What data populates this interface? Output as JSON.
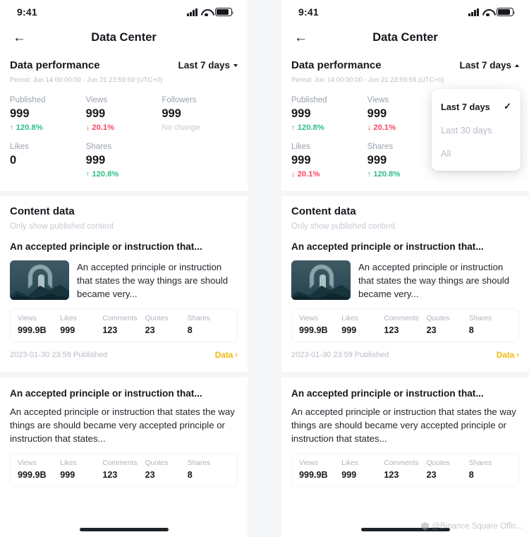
{
  "status_bar": {
    "time": "9:41",
    "icons": {
      "signal": "cellular-signal-icon",
      "wifi": "wifi-icon",
      "battery": "battery-icon"
    }
  },
  "nav": {
    "back_icon": "back-arrow-icon",
    "title": "Data Center"
  },
  "performance": {
    "title": "Data performance",
    "period_label": "Period: Jun 14 00:00:00 - Jun 21 23:59:59 (UTC+0)",
    "range_selected": "Last 7 days",
    "stats_left": [
      {
        "label": "Published",
        "value": "999",
        "delta": "↑ 120.8%",
        "dir": "up"
      },
      {
        "label": "Views",
        "value": "999",
        "delta": "↓ 20.1%",
        "dir": "down"
      },
      {
        "label": "Followers",
        "value": "999",
        "delta": "No change",
        "dir": "flat"
      },
      {
        "label": "Likes",
        "value": "0",
        "delta": "",
        "dir": "none"
      },
      {
        "label": "Shares",
        "value": "999",
        "delta": "↑ 120.8%",
        "dir": "up"
      }
    ],
    "stats_right": [
      {
        "label": "Published",
        "value": "999",
        "delta": "↑ 120.8%",
        "dir": "up"
      },
      {
        "label": "Views",
        "value": "999",
        "delta": "↓ 20.1%",
        "dir": "down"
      },
      {
        "label": "Likes",
        "value": "999",
        "delta": "↓ 20.1%",
        "dir": "down"
      },
      {
        "label": "Shares",
        "value": "999",
        "delta": "↑ 120.8%",
        "dir": "up"
      }
    ]
  },
  "dropdown": {
    "open": true,
    "check_glyph": "✓",
    "options": [
      {
        "label": "Last 7 days",
        "selected": true
      },
      {
        "label": "Last 30 days",
        "selected": false
      },
      {
        "label": "All",
        "selected": false
      }
    ]
  },
  "content": {
    "title": "Content data",
    "subtitle": "Only show published content",
    "cards": [
      {
        "title": "An accepted principle or instruction that...",
        "description": "An accepted principle or instruction that states the way things are should became very...",
        "has_thumbnail": true,
        "thumbnail_alt": "mountain-landscape-thumbnail",
        "metrics": [
          {
            "label": "Views",
            "value": "999.9B"
          },
          {
            "label": "Likes",
            "value": "999"
          },
          {
            "label": "Comments",
            "value": "123"
          },
          {
            "label": "Quotes",
            "value": "23"
          },
          {
            "label": "Shares",
            "value": "8"
          }
        ],
        "published_at": "2023-01-30 23:59 Published",
        "data_link": "Data",
        "data_link_chevron": "›"
      },
      {
        "title": "An accepted principle or instruction that...",
        "description": "An accepted principle or instruction that states the way things are should became very accepted principle or instruction that states...",
        "has_thumbnail": false,
        "metrics": [
          {
            "label": "Views",
            "value": "999.9B"
          },
          {
            "label": "Likes",
            "value": "999"
          },
          {
            "label": "Comments",
            "value": "123"
          },
          {
            "label": "Quotes",
            "value": "23"
          },
          {
            "label": "Shares",
            "value": "8"
          }
        ]
      }
    ]
  },
  "watermark": {
    "text": "@Binance Square Offic...",
    "icon": "shield-badge-icon"
  },
  "colors": {
    "positive": "#2EBD85",
    "negative": "#F6465D",
    "accent": "#F0B90B",
    "text_primary": "#16181D",
    "text_muted": "#B7BDC6",
    "panel_bg": "#FFFFFF",
    "page_bg": "#F5F6F8"
  }
}
